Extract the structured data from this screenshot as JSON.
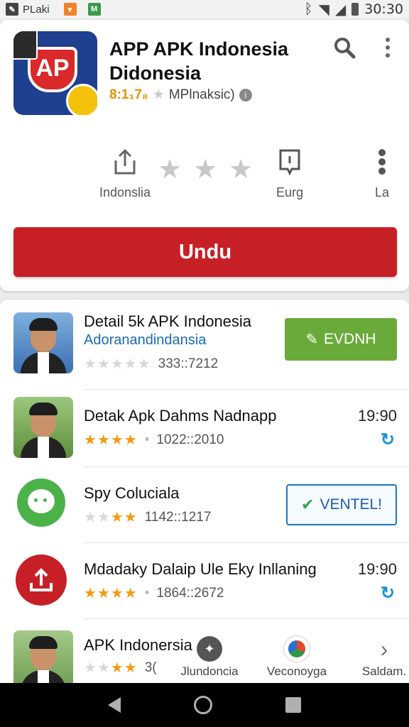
{
  "status_bar": {
    "app_label": "PLaki",
    "time": "30:30"
  },
  "app": {
    "title_line1": "APP APK Indonesia",
    "title_line2": "Didonesia",
    "icon_text": "AP",
    "rating_text": "8:1₁7₈",
    "publisher": "MPlnaksic)"
  },
  "actions": {
    "share_label": "Indonslia",
    "bookmark_label": "Eurg",
    "more_label": "La"
  },
  "primary_button": "Undu",
  "list": [
    {
      "title": "Detail 5k APK Indonesia",
      "subtitle": "Adoranandindansia",
      "stars_on": 0,
      "meta": "333::7212",
      "action": "EVDNH"
    },
    {
      "title": "Detak Apk Dahms Nadnapp",
      "stars_on": 4,
      "meta": "1022::2010",
      "time": "19:90"
    },
    {
      "title": "Spy Coluciala",
      "stars_on": 3,
      "meta": "1142::1217",
      "action": "VENTEL!"
    },
    {
      "title": "Mdadaky Dalaip Ule Eky Inllaning",
      "stars_on": 4,
      "meta": "1864::2672",
      "time": "19:90"
    },
    {
      "title": "APK Indonersia",
      "stars_on": 3,
      "meta": "3("
    }
  ],
  "bottom_tabs": [
    {
      "label": "Jlundoncia"
    },
    {
      "label": "Veconoyga"
    },
    {
      "label": "Saldam."
    }
  ],
  "colors": {
    "primary_red": "#c62026",
    "green": "#6aaa3a",
    "blue": "#1a78c2",
    "star": "#f29b12"
  }
}
